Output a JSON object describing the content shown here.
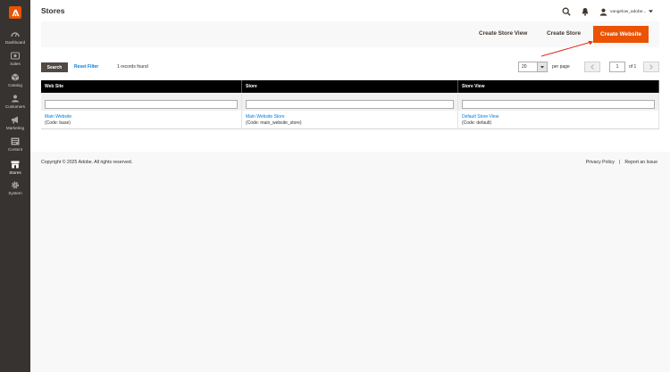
{
  "sidebar": {
    "logo": "adobe-logo",
    "items": [
      {
        "label": "Dashboard",
        "icon": "speedometer-icon"
      },
      {
        "label": "Sales",
        "icon": "dollar-icon"
      },
      {
        "label": "Catalog",
        "icon": "cube-icon"
      },
      {
        "label": "Customers",
        "icon": "customers-icon"
      },
      {
        "label": "Marketing",
        "icon": "megaphone-icon"
      },
      {
        "label": "Content",
        "icon": "content-icon"
      },
      {
        "label": "Stores",
        "icon": "store-icon"
      },
      {
        "label": "System",
        "icon": "gear-icon"
      }
    ],
    "active": "Stores"
  },
  "header": {
    "title": "Stores",
    "user": "vangeluw_adobe..."
  },
  "actions": {
    "create_store_view": "Create Store View",
    "create_store": "Create Store",
    "create_website": "Create Website"
  },
  "grid": {
    "search_label": "Search",
    "reset_label": "Reset Filter",
    "records": "1 records found",
    "per_page_value": "20",
    "per_page_label": "per page",
    "page_value": "1",
    "page_of": "of 1",
    "columns": [
      "Web Site",
      "Store",
      "Store View"
    ],
    "rows": [
      {
        "website": "Main Website",
        "website_code": "(Code: base)",
        "store": "Main Website Store",
        "store_code": "(Code: main_website_store)",
        "store_view": "Default Store View",
        "store_view_code": "(Code: default)"
      }
    ]
  },
  "footer": {
    "copyright": "Copyright © 2025 Adobe. All rights reserved.",
    "privacy": "Privacy Policy",
    "separator": "|",
    "report": "Report an Issue"
  },
  "colors": {
    "accent": "#eb5202",
    "sidebar": "#373330",
    "link": "#007bdb",
    "annotation_arrow": "#e02b1b"
  }
}
